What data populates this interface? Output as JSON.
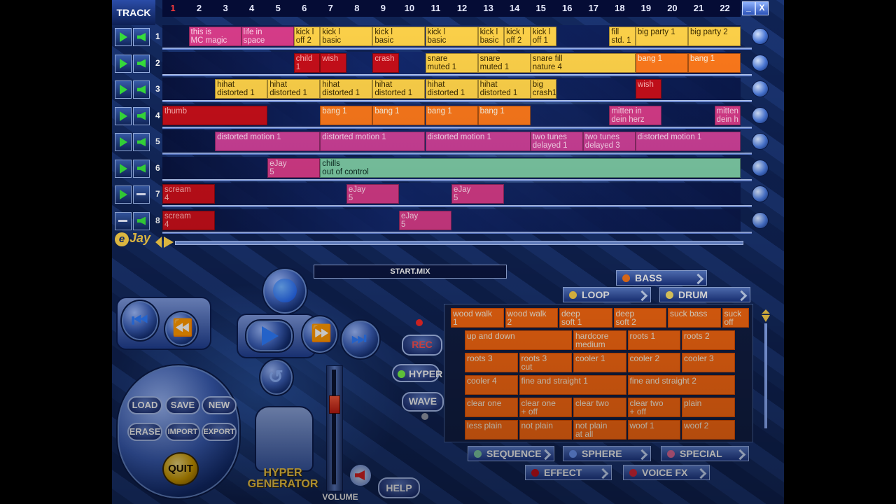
{
  "header": {
    "title": "TRACK",
    "beats": [
      "1",
      "2",
      "3",
      "4",
      "5",
      "6",
      "7",
      "8",
      "9",
      "10",
      "11",
      "12",
      "13",
      "14",
      "15",
      "16",
      "17",
      "18",
      "19",
      "20",
      "21",
      "22"
    ],
    "window_buttons": {
      "minimize": "_",
      "close": "X"
    }
  },
  "tracks": [
    {
      "number": "1",
      "play_active": true,
      "sound_active": true,
      "blocks": [
        {
          "label": "this is\nMC magic",
          "color": "magenta",
          "start": 1,
          "len": 2
        },
        {
          "label": "life in\nspace",
          "color": "magenta",
          "start": 3,
          "len": 2
        },
        {
          "label": "kick l\noff 2",
          "color": "yellow",
          "start": 5,
          "len": 1
        },
        {
          "label": "kick l\nbasic",
          "color": "yellow",
          "start": 6,
          "len": 2
        },
        {
          "label": "kick l\nbasic",
          "color": "yellow",
          "start": 8,
          "len": 2
        },
        {
          "label": "kick l\nbasic",
          "color": "yellow",
          "start": 10,
          "len": 2
        },
        {
          "label": "kick l\nbasic",
          "color": "yellow",
          "start": 12,
          "len": 1
        },
        {
          "label": "kick l\noff 2",
          "color": "yellow",
          "start": 13,
          "len": 1
        },
        {
          "label": "kick l\noff 1",
          "color": "yellow",
          "start": 14,
          "len": 1
        },
        {
          "label": "fill\nstd. 1",
          "color": "yellow",
          "start": 17,
          "len": 1
        },
        {
          "label": "big party 1",
          "color": "yellow",
          "start": 18,
          "len": 2
        },
        {
          "label": "big party 2",
          "color": "yellow",
          "start": 20,
          "len": 2
        }
      ]
    },
    {
      "number": "2",
      "play_active": true,
      "sound_active": true,
      "blocks": [
        {
          "label": "child\n1",
          "color": "red",
          "start": 5,
          "len": 1
        },
        {
          "label": "wish",
          "color": "red",
          "start": 6,
          "len": 1
        },
        {
          "label": "crash",
          "color": "red",
          "start": 8,
          "len": 1
        },
        {
          "label": "snare\nmuted 1",
          "color": "yellow",
          "start": 10,
          "len": 2
        },
        {
          "label": "snare\nmuted 1",
          "color": "yellow",
          "start": 12,
          "len": 2
        },
        {
          "label": "snare fill\nnature 4",
          "color": "yellow",
          "start": 14,
          "len": 4
        },
        {
          "label": "bang 1",
          "color": "orange",
          "start": 18,
          "len": 2
        },
        {
          "label": "bang 1",
          "color": "orange",
          "start": 20,
          "len": 2
        }
      ]
    },
    {
      "number": "3",
      "play_active": true,
      "sound_active": true,
      "blocks": [
        {
          "label": "hihat\ndistorted 1",
          "color": "yellow",
          "start": 2,
          "len": 2
        },
        {
          "label": "hihat\ndistorted 1",
          "color": "yellow",
          "start": 4,
          "len": 2
        },
        {
          "label": "hihat\ndistorted 1",
          "color": "yellow",
          "start": 6,
          "len": 2
        },
        {
          "label": "hihat\ndistorted 1",
          "color": "yellow",
          "start": 8,
          "len": 2
        },
        {
          "label": "hihat\ndistorted 1",
          "color": "yellow",
          "start": 10,
          "len": 2
        },
        {
          "label": "hihat\ndistorted 1",
          "color": "yellow",
          "start": 12,
          "len": 2
        },
        {
          "label": "big\ncrash1",
          "color": "yellow",
          "start": 14,
          "len": 1
        },
        {
          "label": "wish",
          "color": "red",
          "start": 18,
          "len": 1
        }
      ]
    },
    {
      "number": "4",
      "play_active": true,
      "sound_active": true,
      "blocks": [
        {
          "label": "thumb",
          "color": "red",
          "start": 0,
          "len": 4
        },
        {
          "label": "bang 1",
          "color": "orange",
          "start": 6,
          "len": 2
        },
        {
          "label": "bang 1",
          "color": "orange",
          "start": 8,
          "len": 2
        },
        {
          "label": "bang 1",
          "color": "orange",
          "start": 10,
          "len": 2
        },
        {
          "label": "bang 1",
          "color": "orange",
          "start": 12,
          "len": 2
        },
        {
          "label": "mitten in\ndein herz",
          "color": "magenta",
          "start": 17,
          "len": 2
        },
        {
          "label": "mitten in\ndein h",
          "color": "magenta",
          "start": 21,
          "len": 1
        }
      ]
    },
    {
      "number": "5",
      "play_active": true,
      "sound_active": true,
      "blocks": [
        {
          "label": "distorted motion 1",
          "color": "pink",
          "start": 2,
          "len": 4
        },
        {
          "label": "distorted motion 1",
          "color": "pink",
          "start": 6,
          "len": 4
        },
        {
          "label": "distorted motion 1",
          "color": "pink",
          "start": 10,
          "len": 4
        },
        {
          "label": "two tunes\ndelayed 1",
          "color": "pink",
          "start": 14,
          "len": 2
        },
        {
          "label": "two tunes\ndelayed 3",
          "color": "pink",
          "start": 16,
          "len": 2
        },
        {
          "label": "distorted motion 1",
          "color": "pink",
          "start": 18,
          "len": 4
        }
      ]
    },
    {
      "number": "6",
      "play_active": true,
      "sound_active": true,
      "blocks": [
        {
          "label": "eJay\n5",
          "color": "magenta",
          "start": 4,
          "len": 2
        },
        {
          "label": "chills\nout of control",
          "color": "teal",
          "start": 6,
          "len": 16
        }
      ]
    },
    {
      "number": "7",
      "play_active": true,
      "sound_active": false,
      "blocks": [
        {
          "label": "scream\n4",
          "color": "red",
          "start": 0,
          "len": 2
        },
        {
          "label": "eJay\n5",
          "color": "magenta",
          "start": 7,
          "len": 2
        },
        {
          "label": "eJay\n5",
          "color": "magenta",
          "start": 11,
          "len": 2
        }
      ]
    },
    {
      "number": "8",
      "play_active": false,
      "sound_active": true,
      "blocks": [
        {
          "label": "scream\n4",
          "color": "red",
          "start": 0,
          "len": 2
        },
        {
          "label": "eJay\n5",
          "color": "magenta",
          "start": 9,
          "len": 2
        }
      ]
    }
  ],
  "brand": {
    "logo_text": "Jay",
    "logo_e": "e"
  },
  "mix_name": "START.MIX",
  "categories": {
    "bass": "BASS",
    "loop": "LOOP",
    "drum": "DRUM",
    "sequence": "SEQUENCE",
    "sphere": "SPHERE",
    "special": "SPECIAL",
    "effect": "EFFECT",
    "voice_fx": "VOICE FX"
  },
  "category_colors": {
    "bass": "#ff7a1c",
    "loop": "#ffd34a",
    "drum": "#ffe66b",
    "sequence": "#7fcea8",
    "sphere": "#6f9cff",
    "special": "#e06a9a",
    "effect": "#c80f1a",
    "voice_fx": "#e0283a"
  },
  "samples": [
    {
      "label": "wood walk\n1",
      "row": 0,
      "col": 0
    },
    {
      "label": "wood walk\n2",
      "row": 0,
      "col": 1
    },
    {
      "label": "deep\nsoft 1",
      "row": 0,
      "col": 2
    },
    {
      "label": "deep\nsoft 2",
      "row": 0,
      "col": 3
    },
    {
      "label": "suck bass",
      "row": 0,
      "col": 4
    },
    {
      "label": "suck\noff",
      "row": 0,
      "col": 5
    },
    {
      "label": "up and down",
      "row": 1,
      "col": 0,
      "wide": true
    },
    {
      "label": "hardcore\nmedium",
      "row": 1,
      "col": 2
    },
    {
      "label": "roots 1",
      "row": 1,
      "col": 3
    },
    {
      "label": "roots 2",
      "row": 1,
      "col": 4
    },
    {
      "label": "roots 3",
      "row": 2,
      "col": 0
    },
    {
      "label": "roots 3\ncut",
      "row": 2,
      "col": 1
    },
    {
      "label": "cooler 1",
      "row": 2,
      "col": 2
    },
    {
      "label": "cooler 2",
      "row": 2,
      "col": 3
    },
    {
      "label": "cooler 3",
      "row": 2,
      "col": 4
    },
    {
      "label": "cooler 4",
      "row": 3,
      "col": 0
    },
    {
      "label": "fine and straight 1",
      "row": 3,
      "col": 1,
      "wide": true
    },
    {
      "label": "fine and straight 2",
      "row": 3,
      "col": 3,
      "wide": true
    },
    {
      "label": "clear one",
      "row": 4,
      "col": 0
    },
    {
      "label": "clear one\n+ off",
      "row": 4,
      "col": 1
    },
    {
      "label": "clear two",
      "row": 4,
      "col": 2
    },
    {
      "label": "clear two\n+ off",
      "row": 4,
      "col": 3
    },
    {
      "label": "plain",
      "row": 4,
      "col": 4
    },
    {
      "label": "less plain",
      "row": 5,
      "col": 0
    },
    {
      "label": "not plain",
      "row": 5,
      "col": 1
    },
    {
      "label": "not plain\nat all",
      "row": 5,
      "col": 2
    },
    {
      "label": "woof 1",
      "row": 5,
      "col": 3
    },
    {
      "label": "woof 2",
      "row": 5,
      "col": 4
    }
  ],
  "controls": {
    "load": "LOAD",
    "save": "SAVE",
    "new": "NEW",
    "erase": "ERASE",
    "import": "IMPORT",
    "export": "EXPORT",
    "quit": "QUIT",
    "rec": "REC",
    "hyper": "HYPER",
    "wave": "WAVE",
    "help": "HELP",
    "volume": "VOLUME",
    "hyper_generator": "HYPER\nGENERATOR",
    "volume_level": 0.7
  },
  "block_colors": {
    "yellow": "#ffd34a",
    "orange": "#ff7a1c",
    "red": "#c80f1a",
    "pink": "#d0419a",
    "magenta": "#d83c8a",
    "teal": "#7fcea8"
  }
}
